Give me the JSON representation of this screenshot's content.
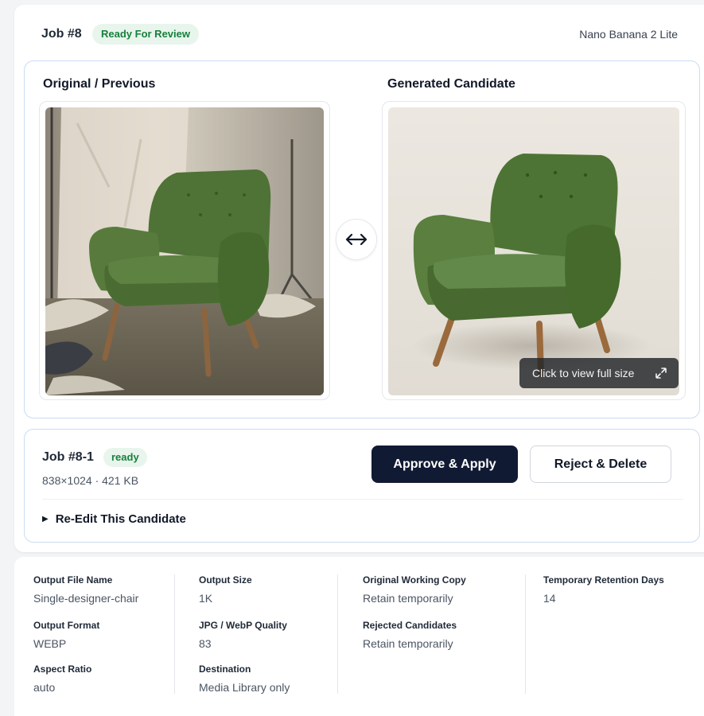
{
  "header": {
    "job_title": "Job #8",
    "status": "Ready For Review",
    "model": "Nano Banana 2 Lite"
  },
  "comparison": {
    "left_heading": "Original / Previous",
    "right_heading": "Generated Candidate",
    "full_size_label": "Click to view full size"
  },
  "candidate": {
    "title": "Job #8-1",
    "status": "ready",
    "meta": "838×1024 · 421 KB",
    "approve_label": "Approve & Apply",
    "reject_label": "Reject & Delete",
    "reedit_label": "Re-Edit This Candidate"
  },
  "settings": {
    "output_file_name": {
      "label": "Output File Name",
      "value": "Single-designer-chair"
    },
    "output_format": {
      "label": "Output Format",
      "value": "WEBP"
    },
    "aspect_ratio": {
      "label": "Aspect Ratio",
      "value": "auto"
    },
    "output_size": {
      "label": "Output Size",
      "value": "1K"
    },
    "quality": {
      "label": "JPG / WebP Quality",
      "value": "83"
    },
    "destination": {
      "label": "Destination",
      "value": "Media Library only"
    },
    "original_copy": {
      "label": "Original Working Copy",
      "value": "Retain temporarily"
    },
    "rejected": {
      "label": "Rejected Candidates",
      "value": "Retain temporarily"
    },
    "retention_days": {
      "label": "Temporary Retention Days",
      "value": "14"
    }
  },
  "colors": {
    "accent_dark": "#111a33",
    "status_green": "#16803c",
    "status_green_bg": "#e8f5ec",
    "panel_border": "#c9dcf3",
    "chair_green": "#52763a"
  },
  "icons": {
    "swap": "left-right-arrows-icon",
    "expand": "expand-icon",
    "disclosure": "triangle-right-icon"
  }
}
